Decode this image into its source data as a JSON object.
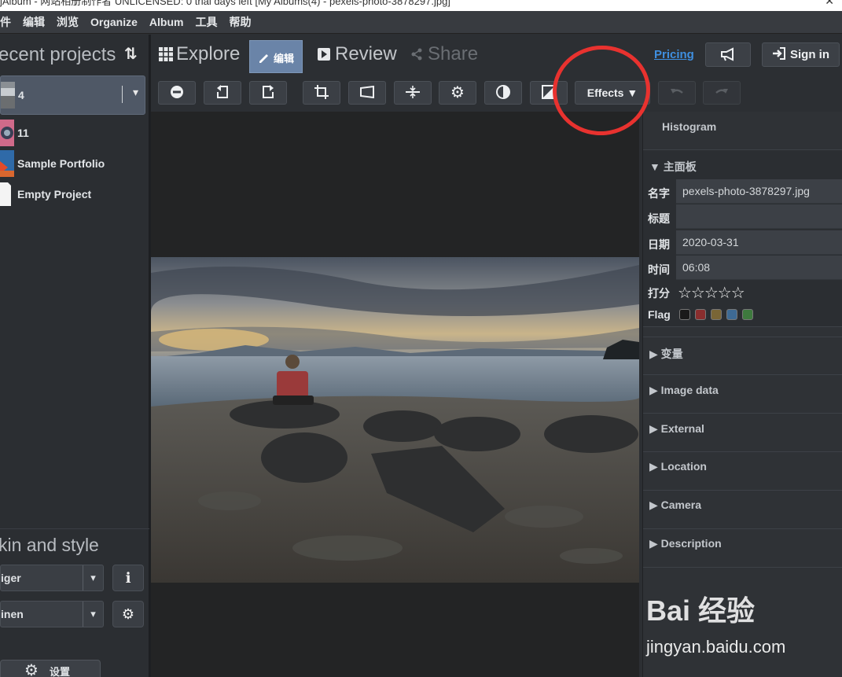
{
  "window": {
    "title": "jAlbum - 网站相册制作者 UNLICENSED: 0 trial days left [My Albums(4) - pexels-photo-3878297.jpg]",
    "close": "✕"
  },
  "menu": [
    "件",
    "编辑",
    "浏览",
    "Organize",
    "Album",
    "工具",
    "帮助"
  ],
  "left": {
    "recent_header": "ecent projects",
    "sort_icon": "⇅",
    "projects": [
      {
        "name": "4",
        "selected": true
      },
      {
        "name": "11"
      },
      {
        "name": "Sample Portfolio"
      },
      {
        "name": "Empty Project"
      }
    ],
    "dropdown_arrow": "▾",
    "skin_header": "kin and style",
    "skin_value": "iger",
    "style_value": "inen",
    "select_arrow": "▾",
    "info_icon": "ℹ",
    "gear_icon": "⚙",
    "settings_label": "设置"
  },
  "tabs": {
    "explore": "Explore",
    "edit": "编辑",
    "review": "Review",
    "share": "Share",
    "pricing": "Pricing",
    "signin": "Sign in"
  },
  "toolbar": {
    "effects": "Effects ▼"
  },
  "right": {
    "histogram": "Histogram",
    "main_panel": "▼ 主面板",
    "fields": [
      {
        "key": "名字",
        "value": "pexels-photo-3878297.jpg"
      },
      {
        "key": "标题",
        "value": ""
      },
      {
        "key": "日期",
        "value": "2020-03-31"
      },
      {
        "key": "时间",
        "value": "06:08"
      }
    ],
    "rating_label": "打分",
    "rating_stars": "☆☆☆☆☆",
    "rating_value": 0,
    "flag_label": "Flag",
    "flag_colors": [
      "#1a1a1a",
      "#8a2e2e",
      "#7a6636",
      "#3e6a94",
      "#3e7a3e"
    ],
    "sections": [
      "▶ 变量",
      "▶ Image data",
      "▶ External",
      "▶ Location",
      "▶ Camera",
      "▶ Description"
    ]
  },
  "watermark": {
    "logo": "Bai 经验",
    "site": "jingyan.baidu.com"
  },
  "colors": {
    "accent_tab": "#6a84a8",
    "pricing_link": "#3f8fe0",
    "annotation": "#e8322f"
  }
}
